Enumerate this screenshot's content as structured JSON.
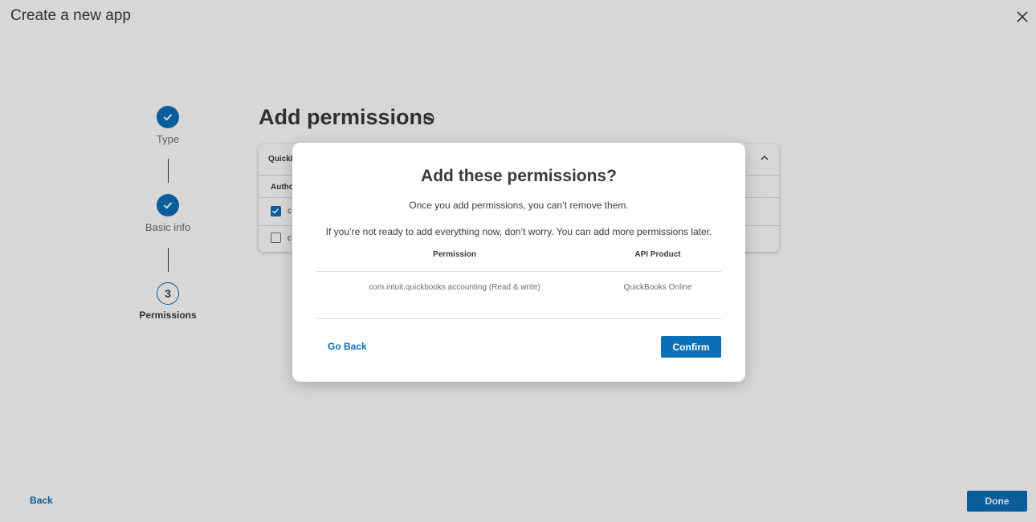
{
  "header": {
    "title": "Create a new app",
    "close_icon": "close-icon"
  },
  "stepper": {
    "steps": [
      {
        "label": "Type",
        "state": "complete",
        "icon": "check-icon"
      },
      {
        "label": "Basic info",
        "state": "complete",
        "icon": "check-icon"
      },
      {
        "label": "Permissions",
        "state": "current",
        "number": "3"
      }
    ]
  },
  "main": {
    "title": "Add permissions",
    "info_icon": "info-icon",
    "card": {
      "header_text": "QuickB",
      "column_text": "Autho",
      "rows": [
        {
          "checked": true,
          "text": "c"
        },
        {
          "checked": false,
          "text": "c"
        }
      ]
    }
  },
  "footer": {
    "back_label": "Back",
    "done_label": "Done"
  },
  "modal": {
    "title": "Add these permissions?",
    "subtitle1": "Once you add permissions, you can’t remove them.",
    "subtitle2": "If you’re not ready to add everything now, don’t worry. You can add more permissions later.",
    "columns": [
      "Permission",
      "API Product"
    ],
    "rows": [
      {
        "permission": "com.intuit.quickbooks.accounting (Read & write)",
        "product": "QuickBooks Online"
      }
    ],
    "go_back_label": "Go Back",
    "confirm_label": "Confirm"
  },
  "colors": {
    "accent": "#0b6fb8",
    "text": "#393a3d",
    "muted": "#6b6c72",
    "overlay": "#d6d6d6"
  }
}
